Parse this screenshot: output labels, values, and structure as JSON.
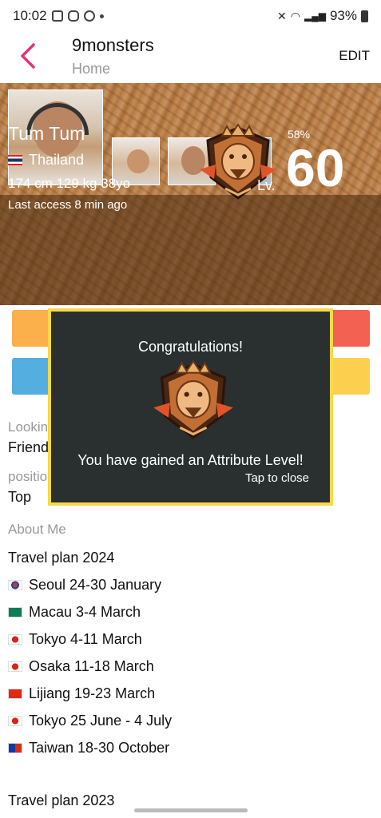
{
  "status_bar": {
    "time": "10:02",
    "battery": "93%"
  },
  "header": {
    "title": "9monsters",
    "subtitle": "Home",
    "edit_label": "EDIT"
  },
  "profile": {
    "name": "Tum Tum",
    "country": "Thailand",
    "stats": "174 cm 129 kg 38yo",
    "last_access": "Last access 8 min ago",
    "photo_count": "6",
    "level_prefix": "Lv.",
    "level_percent": "58%",
    "level": "60"
  },
  "sections": {
    "looking_label": "Looking for",
    "looking_value": "Friends",
    "position_label": "position",
    "position_value": "Top",
    "about_label": "About Me"
  },
  "about_lines": {
    "plan_2024": "Travel plan 2024",
    "l1": "Seoul 24-30 January",
    "l2": "Macau 3-4 March",
    "l3": "Tokyo 4-11 March",
    "l4": "Osaka 11-18 March",
    "l5": "Lijiang  19-23 March",
    "l6": "Tokyo 25 June - 4 July",
    "l7": "Taiwan 18-30 October",
    "plan_2023": "Travel plan 2023"
  },
  "modal": {
    "title": "Congratulations!",
    "message": "You have gained an Attribute Level!",
    "close_label": "Tap to close"
  },
  "colors": {
    "accent_back": "#e0357a",
    "modal_border": "#f7d84a",
    "modal_bg": "#29302f",
    "btn_orange": "#fbb04c",
    "btn_red": "#f26152",
    "btn_blue": "#55aee0",
    "btn_yellow": "#fdcf4f"
  }
}
